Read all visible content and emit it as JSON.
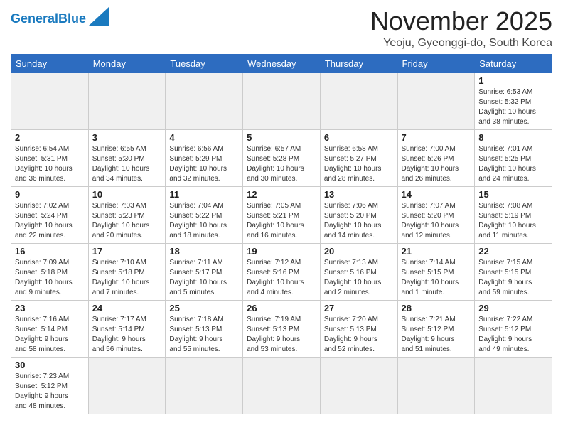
{
  "logo": {
    "text_general": "General",
    "text_blue": "Blue"
  },
  "header": {
    "month": "November 2025",
    "location": "Yeoju, Gyeonggi-do, South Korea"
  },
  "weekdays": [
    "Sunday",
    "Monday",
    "Tuesday",
    "Wednesday",
    "Thursday",
    "Friday",
    "Saturday"
  ],
  "weeks": [
    [
      {
        "day": "",
        "empty": true
      },
      {
        "day": "",
        "empty": true
      },
      {
        "day": "",
        "empty": true
      },
      {
        "day": "",
        "empty": true
      },
      {
        "day": "",
        "empty": true
      },
      {
        "day": "",
        "empty": true
      },
      {
        "day": "1",
        "info": "Sunrise: 6:53 AM\nSunset: 5:32 PM\nDaylight: 10 hours\nand 38 minutes."
      }
    ],
    [
      {
        "day": "2",
        "info": "Sunrise: 6:54 AM\nSunset: 5:31 PM\nDaylight: 10 hours\nand 36 minutes."
      },
      {
        "day": "3",
        "info": "Sunrise: 6:55 AM\nSunset: 5:30 PM\nDaylight: 10 hours\nand 34 minutes."
      },
      {
        "day": "4",
        "info": "Sunrise: 6:56 AM\nSunset: 5:29 PM\nDaylight: 10 hours\nand 32 minutes."
      },
      {
        "day": "5",
        "info": "Sunrise: 6:57 AM\nSunset: 5:28 PM\nDaylight: 10 hours\nand 30 minutes."
      },
      {
        "day": "6",
        "info": "Sunrise: 6:58 AM\nSunset: 5:27 PM\nDaylight: 10 hours\nand 28 minutes."
      },
      {
        "day": "7",
        "info": "Sunrise: 7:00 AM\nSunset: 5:26 PM\nDaylight: 10 hours\nand 26 minutes."
      },
      {
        "day": "8",
        "info": "Sunrise: 7:01 AM\nSunset: 5:25 PM\nDaylight: 10 hours\nand 24 minutes."
      }
    ],
    [
      {
        "day": "9",
        "info": "Sunrise: 7:02 AM\nSunset: 5:24 PM\nDaylight: 10 hours\nand 22 minutes."
      },
      {
        "day": "10",
        "info": "Sunrise: 7:03 AM\nSunset: 5:23 PM\nDaylight: 10 hours\nand 20 minutes."
      },
      {
        "day": "11",
        "info": "Sunrise: 7:04 AM\nSunset: 5:22 PM\nDaylight: 10 hours\nand 18 minutes."
      },
      {
        "day": "12",
        "info": "Sunrise: 7:05 AM\nSunset: 5:21 PM\nDaylight: 10 hours\nand 16 minutes."
      },
      {
        "day": "13",
        "info": "Sunrise: 7:06 AM\nSunset: 5:20 PM\nDaylight: 10 hours\nand 14 minutes."
      },
      {
        "day": "14",
        "info": "Sunrise: 7:07 AM\nSunset: 5:20 PM\nDaylight: 10 hours\nand 12 minutes."
      },
      {
        "day": "15",
        "info": "Sunrise: 7:08 AM\nSunset: 5:19 PM\nDaylight: 10 hours\nand 11 minutes."
      }
    ],
    [
      {
        "day": "16",
        "info": "Sunrise: 7:09 AM\nSunset: 5:18 PM\nDaylight: 10 hours\nand 9 minutes."
      },
      {
        "day": "17",
        "info": "Sunrise: 7:10 AM\nSunset: 5:18 PM\nDaylight: 10 hours\nand 7 minutes."
      },
      {
        "day": "18",
        "info": "Sunrise: 7:11 AM\nSunset: 5:17 PM\nDaylight: 10 hours\nand 5 minutes."
      },
      {
        "day": "19",
        "info": "Sunrise: 7:12 AM\nSunset: 5:16 PM\nDaylight: 10 hours\nand 4 minutes."
      },
      {
        "day": "20",
        "info": "Sunrise: 7:13 AM\nSunset: 5:16 PM\nDaylight: 10 hours\nand 2 minutes."
      },
      {
        "day": "21",
        "info": "Sunrise: 7:14 AM\nSunset: 5:15 PM\nDaylight: 10 hours\nand 1 minute."
      },
      {
        "day": "22",
        "info": "Sunrise: 7:15 AM\nSunset: 5:15 PM\nDaylight: 9 hours\nand 59 minutes."
      }
    ],
    [
      {
        "day": "23",
        "info": "Sunrise: 7:16 AM\nSunset: 5:14 PM\nDaylight: 9 hours\nand 58 minutes."
      },
      {
        "day": "24",
        "info": "Sunrise: 7:17 AM\nSunset: 5:14 PM\nDaylight: 9 hours\nand 56 minutes."
      },
      {
        "day": "25",
        "info": "Sunrise: 7:18 AM\nSunset: 5:13 PM\nDaylight: 9 hours\nand 55 minutes."
      },
      {
        "day": "26",
        "info": "Sunrise: 7:19 AM\nSunset: 5:13 PM\nDaylight: 9 hours\nand 53 minutes."
      },
      {
        "day": "27",
        "info": "Sunrise: 7:20 AM\nSunset: 5:13 PM\nDaylight: 9 hours\nand 52 minutes."
      },
      {
        "day": "28",
        "info": "Sunrise: 7:21 AM\nSunset: 5:12 PM\nDaylight: 9 hours\nand 51 minutes."
      },
      {
        "day": "29",
        "info": "Sunrise: 7:22 AM\nSunset: 5:12 PM\nDaylight: 9 hours\nand 49 minutes."
      }
    ],
    [
      {
        "day": "30",
        "info": "Sunrise: 7:23 AM\nSunset: 5:12 PM\nDaylight: 9 hours\nand 48 minutes."
      },
      {
        "day": "",
        "empty": true
      },
      {
        "day": "",
        "empty": true
      },
      {
        "day": "",
        "empty": true
      },
      {
        "day": "",
        "empty": true
      },
      {
        "day": "",
        "empty": true
      },
      {
        "day": "",
        "empty": true
      }
    ]
  ]
}
